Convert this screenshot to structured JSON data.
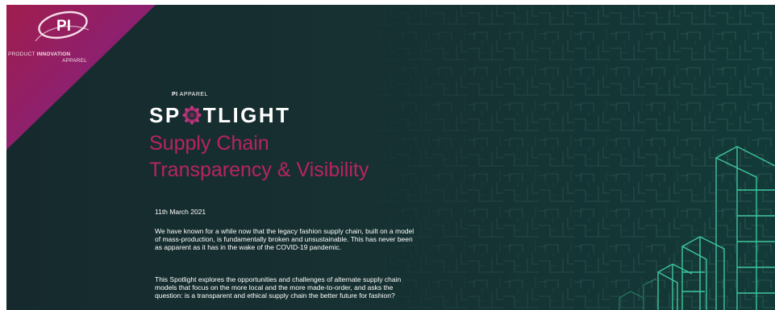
{
  "brand": {
    "logo_text": "PI",
    "line1_regular": "PRODUCT ",
    "line1_bold": "INNOVATION",
    "line2": "APPAREL"
  },
  "spotlight": {
    "kicker_pi": "PI",
    "kicker_rest": " APPAREL",
    "word_start": "SP",
    "word_end": "TLIGHT"
  },
  "headline": {
    "line1": "Supply Chain",
    "line2": "Transparency & Visibility"
  },
  "date": "11th March 2021",
  "paragraphs": [
    "We have known for a while now that the legacy fashion supply chain, built on a model of mass-production, is fundamentally broken and unsustainable. This has never been as apparent as it has in the wake of the COVID-19 pandemic.",
    "This Spotlight explores the opportunities and challenges of alternate supply chain models that focus on the more local and the more made-to-order, and asks the question: is a transparent and ethical supply chain the better future for fashion?"
  ],
  "colors": {
    "background": "#162a2d",
    "accent_magenta": "#b82461",
    "maze_line": "#2c5450",
    "building_line": "#3fc79d"
  }
}
